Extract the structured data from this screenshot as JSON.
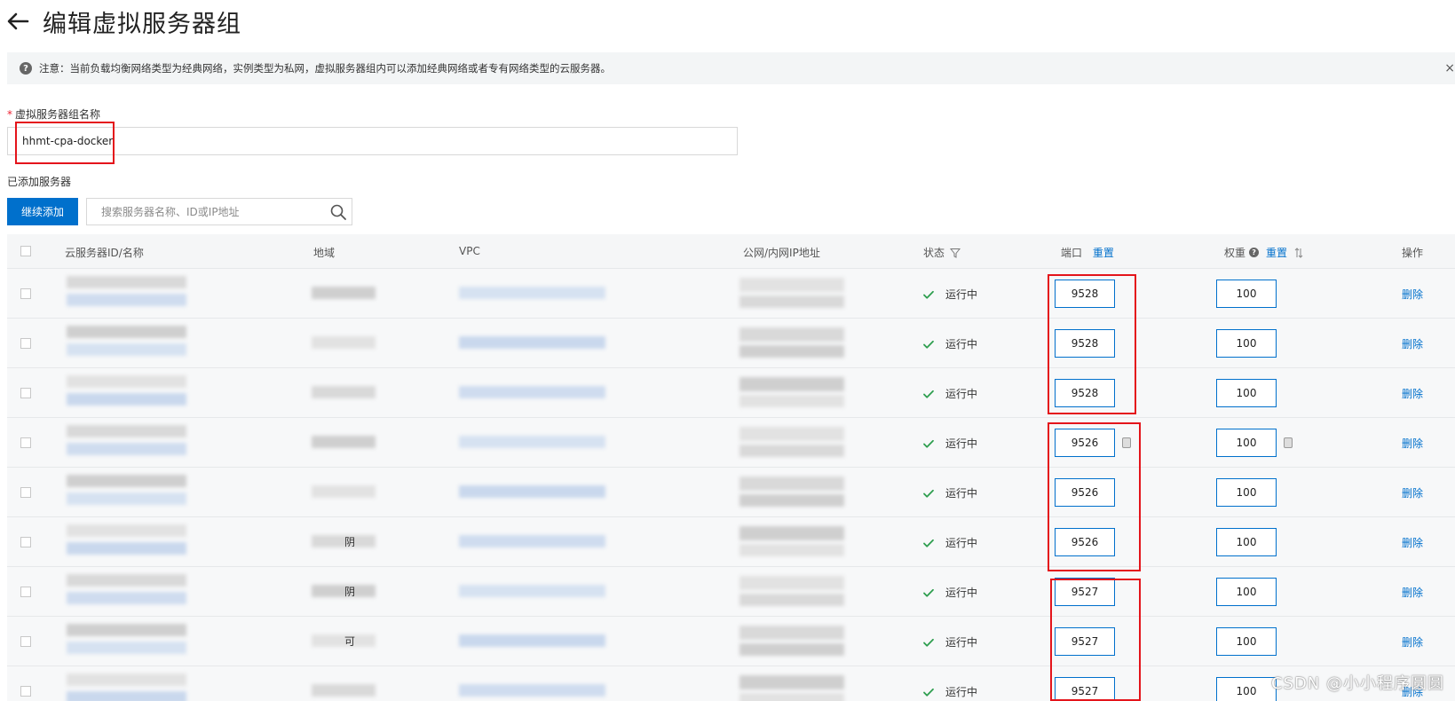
{
  "header": {
    "title": "编辑虚拟服务器组"
  },
  "notice": {
    "text": "注意：当前负载均衡网络类型为经典网络，实例类型为私网，虚拟服务器组内可以添加经典网络或者专有网络类型的云服务器。",
    "close": "×"
  },
  "form": {
    "name_label": "虚拟服务器组名称",
    "required_mark": "*",
    "name_value": "hhmt-cpa-docker",
    "added_label": "已添加服务器",
    "add_button": "继续添加",
    "search_placeholder": "搜索服务器名称、ID或IP地址"
  },
  "table": {
    "headers": {
      "server": "云服务器ID/名称",
      "region": "地域",
      "vpc": "VPC",
      "ip": "公网/内网IP地址",
      "status": "状态",
      "port": "端口",
      "port_reset": "重置",
      "weight": "权重",
      "weight_reset": "重置",
      "action": "操作"
    },
    "rows": [
      {
        "region_text": "",
        "status": "运行中",
        "port": "9528",
        "weight": "100",
        "action": "删除"
      },
      {
        "region_text": "",
        "status": "运行中",
        "port": "9528",
        "weight": "100",
        "action": "删除"
      },
      {
        "region_text": "",
        "status": "运行中",
        "port": "9528",
        "weight": "100",
        "action": "删除"
      },
      {
        "region_text": "",
        "status": "运行中",
        "port": "9526",
        "weight": "100",
        "action": "删除"
      },
      {
        "region_text": "",
        "status": "运行中",
        "port": "9526",
        "weight": "100",
        "action": "删除"
      },
      {
        "region_text": "阴",
        "status": "运行中",
        "port": "9526",
        "weight": "100",
        "action": "删除"
      },
      {
        "region_text": "阴",
        "status": "运行中",
        "port": "9527",
        "weight": "100",
        "action": "删除"
      },
      {
        "region_text": "可",
        "status": "运行中",
        "port": "9527",
        "weight": "100",
        "action": "删除"
      },
      {
        "region_text": "",
        "status": "运行中",
        "port": "9527",
        "weight": "100",
        "action": "删除"
      }
    ]
  },
  "watermark": "CSDN @小小程序圆圆",
  "colors": {
    "primary": "#0070cc",
    "highlight": "#e4141b",
    "success": "#2e9e4f"
  }
}
